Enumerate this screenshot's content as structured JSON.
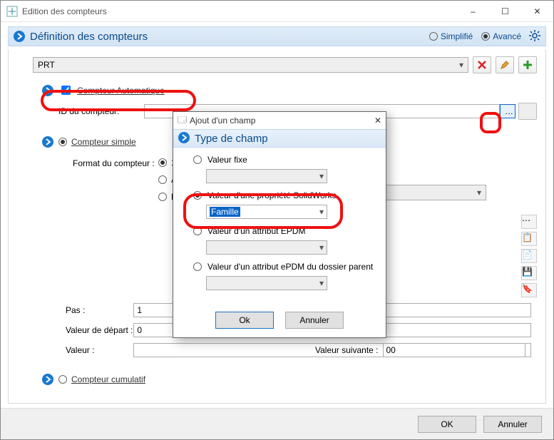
{
  "window": {
    "title": "Edition des compteurs"
  },
  "header": {
    "title": "Définition des compteurs",
    "simple": "Simplifié",
    "advanced": "Avancé"
  },
  "top": {
    "combo": "PRT"
  },
  "auto": {
    "label": "Compteur Automatique",
    "id_lbl": "ID du compteur:"
  },
  "simple": {
    "label": "Compteur simple",
    "fmt_lbl": "Format du compteur :",
    "fmt1": "1,2,…",
    "fmt2": "A,B,…",
    "fmt3": "Liste",
    "step_lbl": "Pas :",
    "step_val": "1",
    "start_lbl": "Valeur de départ :",
    "start_val": "0",
    "val_lbl": "Valeur :",
    "val_val": "",
    "next_lbl": "Valeur suivante :",
    "next_val": "00"
  },
  "cumul": {
    "label": "Compteur cumulatif"
  },
  "footer": {
    "ok": "OK",
    "cancel": "Annuler"
  },
  "modal": {
    "title": "Ajout d'un champ",
    "subtitle": "Type de champ",
    "o1": "Valeur fixe",
    "o2": "Valeur d'une propriété SolidWorks",
    "o2v": "Famille",
    "o3": "Valeur d'un attribut EPDM",
    "o4": "Valeur d'un attribut ePDM du dossier parent",
    "ok": "Ok",
    "cancel": "Annuler"
  }
}
